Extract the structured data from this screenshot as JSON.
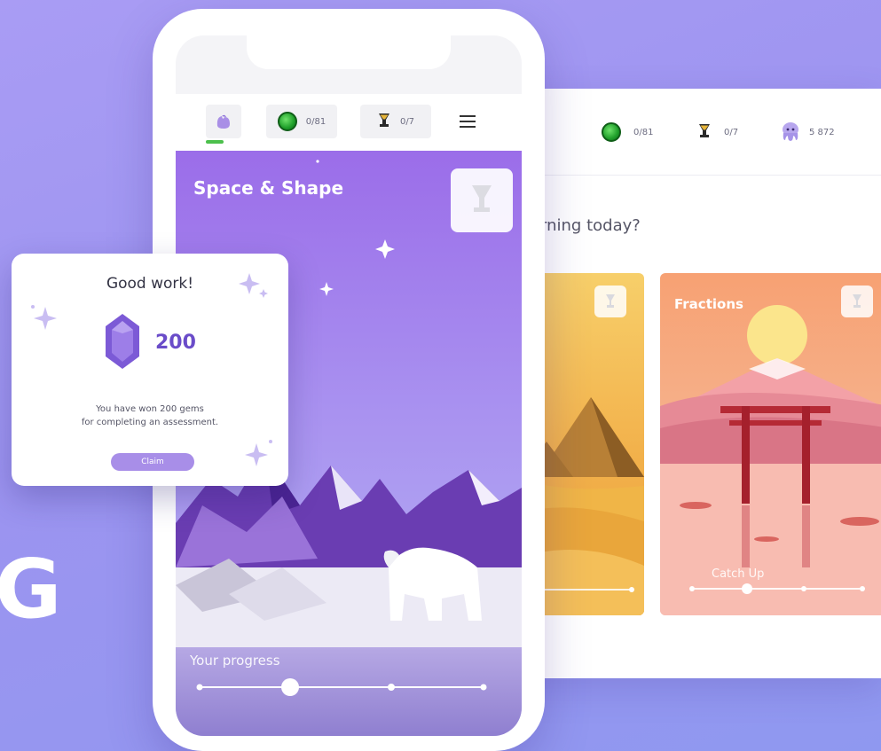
{
  "colors": {
    "background": "#9c94f0",
    "accent_purple": "#6a4cc9",
    "gem_green": "#1f9f2a",
    "claim_button": "#a88ee8"
  },
  "phone": {
    "topbar": {
      "avatar_icon": "lavender-creature-icon",
      "gems_icon": "green-gem-icon",
      "gems_count": "0/81",
      "trophies_icon": "gold-trophy-icon",
      "trophies_count": "0/7",
      "menu_icon": "hamburger-menu-icon"
    },
    "scene": {
      "title": "Space & Shape",
      "progress_label": "Your progress",
      "progress": 0.3
    }
  },
  "tablet": {
    "topbar": {
      "gems_count": "0/81",
      "trophies_count": "0/7",
      "points": "5 872"
    },
    "question": "arning today?",
    "cards": [
      {
        "title": "",
        "progress": 0.9
      },
      {
        "title": "Fractions",
        "status": "Catch Up",
        "progress": 0.33
      }
    ]
  },
  "popup": {
    "title": "Good work!",
    "amount": "200",
    "message_line1": "You have won 200 gems",
    "message_line2": "for completing an assessment.",
    "claim_label": "Claim"
  },
  "background_glyph": "G"
}
